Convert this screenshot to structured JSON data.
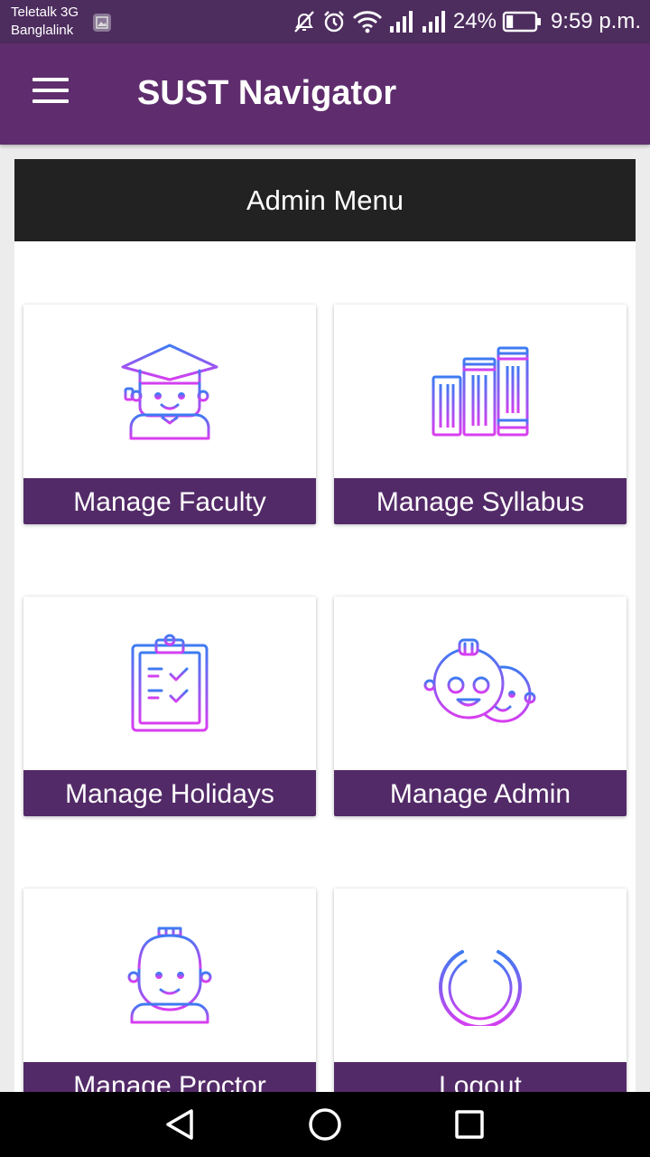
{
  "status_bar": {
    "carrier_1": "Teletalk 3G",
    "carrier_2": "Banglalink",
    "battery": "24%",
    "battery_level": 0.24,
    "time": "9:59 p.m.",
    "icons": [
      "image-icon",
      "mute-icon",
      "alarm-icon",
      "wifi-icon",
      "signal-icon",
      "signal-icon",
      "battery-icon"
    ]
  },
  "app_bar": {
    "title": "SUST Navigator",
    "menu_icon": "hamburger-icon"
  },
  "admin_menu": {
    "header": "Admin Menu",
    "items": [
      {
        "label": "Manage Faculty",
        "icon": "graduate-icon"
      },
      {
        "label": "Manage Syllabus",
        "icon": "books-icon"
      },
      {
        "label": "Manage Holidays",
        "icon": "clipboard-checklist-icon"
      },
      {
        "label": "Manage Admin",
        "icon": "two-faces-icon"
      },
      {
        "label": "Manage Proctor",
        "icon": "proctor-icon"
      },
      {
        "label": "Logout",
        "icon": "power-icon"
      }
    ]
  },
  "colors": {
    "status_bar": "#4d2c5e",
    "app_bar": "#5f2d6e",
    "card_label": "#532a68",
    "panel_header": "#222222",
    "icon_gradient_start": "#3d7bf2",
    "icon_gradient_end": "#d83ef0"
  },
  "nav_bar": {
    "icons": [
      "back-icon",
      "home-icon",
      "recents-icon"
    ]
  }
}
